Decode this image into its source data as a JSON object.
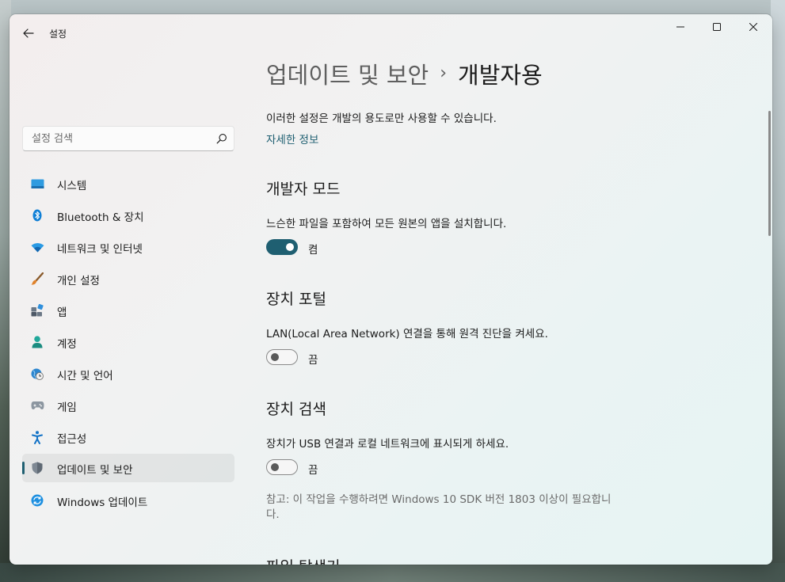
{
  "window": {
    "title": "설정"
  },
  "search": {
    "placeholder": "설정 검색"
  },
  "nav": {
    "items": [
      {
        "label": "시스템"
      },
      {
        "label": "Bluetooth & 장치"
      },
      {
        "label": "네트워크 및 인터넷"
      },
      {
        "label": "개인 설정"
      },
      {
        "label": "앱"
      },
      {
        "label": "계정"
      },
      {
        "label": "시간 및 언어"
      },
      {
        "label": "게임"
      },
      {
        "label": "접근성"
      },
      {
        "label": "업데이트 및 보안"
      },
      {
        "label": "Windows 업데이트"
      }
    ],
    "selected_index": 9
  },
  "breadcrumb": {
    "parent": "업데이트 및 보안",
    "separator": "›",
    "current": "개발자용"
  },
  "intro": {
    "description": "이러한 설정은 개발의 용도로만 사용할 수 있습니다.",
    "link": "자세한 정보"
  },
  "sections": [
    {
      "title": "개발자 모드",
      "description": "느슨한 파일을 포함하여 모든 원본의 앱을 설치합니다.",
      "toggle_on": true,
      "toggle_label": "켬"
    },
    {
      "title": "장치 포털",
      "description": "LAN(Local Area Network) 연결을 통해 원격 진단을 켜세요.",
      "toggle_on": false,
      "toggle_label": "끔"
    },
    {
      "title": "장치 검색",
      "description": "장치가 USB 연결과 로컬 네트워크에 표시되게 하세요.",
      "toggle_on": false,
      "toggle_label": "끔",
      "note": "참고: 이 작업을 수행하려면 Windows 10 SDK 버전 1803 이상이 필요합니다."
    },
    {
      "title": "파일 탐색기"
    }
  ],
  "colors": {
    "accent": "#1f5f71"
  }
}
